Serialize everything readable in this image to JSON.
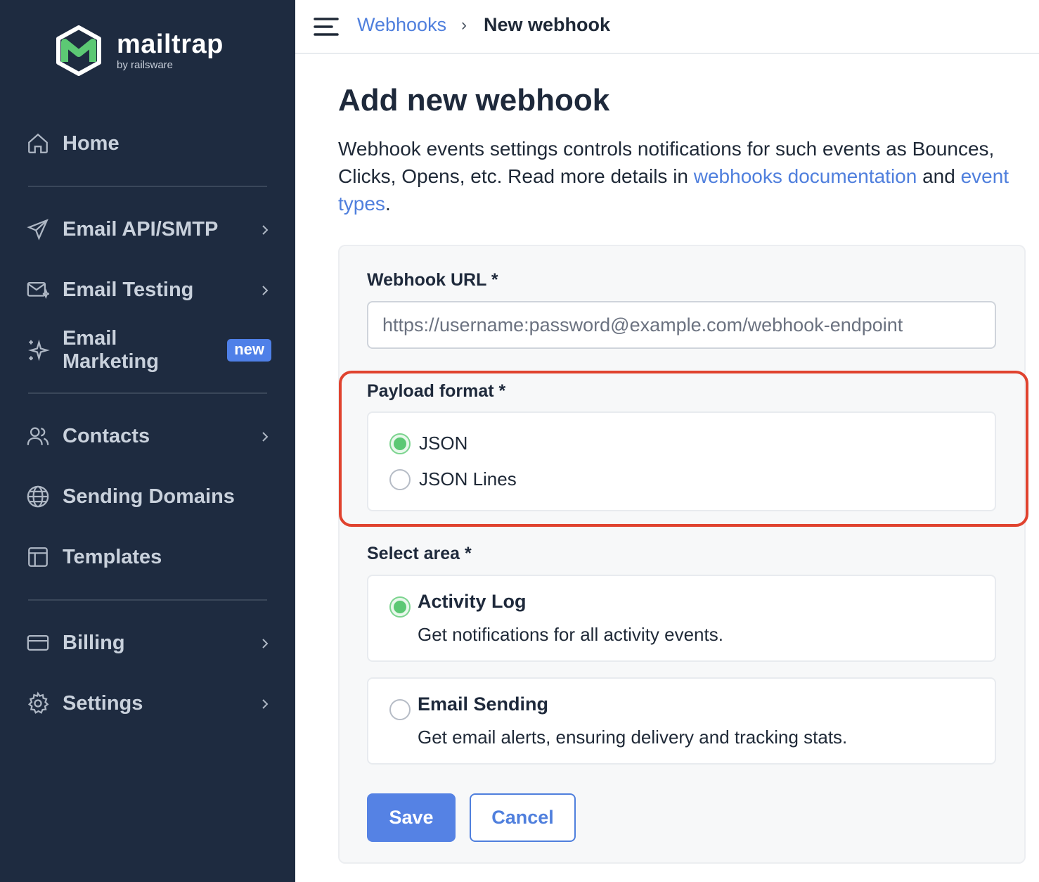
{
  "brand": {
    "name": "mailtrap",
    "sub": "by railsware",
    "accent": "#5cc874"
  },
  "sidebar": {
    "items": [
      {
        "label": "Home",
        "icon": "home-icon"
      },
      {
        "label": "Email API/SMTP",
        "icon": "send-icon"
      },
      {
        "label": "Email Testing",
        "icon": "email-testing-icon"
      },
      {
        "label": "Email Marketing",
        "icon": "sparkle-icon",
        "badge": "new"
      },
      {
        "label": "Contacts",
        "icon": "contacts-icon"
      },
      {
        "label": "Sending Domains",
        "icon": "globe-icon"
      },
      {
        "label": "Templates",
        "icon": "templates-icon"
      },
      {
        "label": "Billing",
        "icon": "credit-card-icon"
      },
      {
        "label": "Settings",
        "icon": "gear-icon"
      }
    ]
  },
  "breadcrumb": {
    "parent": "Webhooks",
    "separator": "›",
    "current": "New webhook"
  },
  "page": {
    "title": "Add new webhook",
    "desc_1": "Webhook events settings controls notifications for such events as Bounces, Clicks, Opens, etc. Read more details in ",
    "link_docs": "webhooks documentation",
    "desc_2": " and ",
    "link_events": "event types",
    "desc_3": "."
  },
  "form": {
    "url_label": "Webhook URL *",
    "url_placeholder": "https://username:password@example.com/webhook-endpoint",
    "payload_label": "Payload format *",
    "payload_options": [
      {
        "label": "JSON",
        "checked": true
      },
      {
        "label": "JSON Lines",
        "checked": false
      }
    ],
    "area_label": "Select area *",
    "areas": [
      {
        "title": "Activity Log",
        "desc": "Get notifications for all activity events.",
        "checked": true
      },
      {
        "title": "Email Sending",
        "desc": "Get email alerts, ensuring delivery and tracking stats.",
        "checked": false
      }
    ],
    "save_label": "Save",
    "cancel_label": "Cancel"
  }
}
